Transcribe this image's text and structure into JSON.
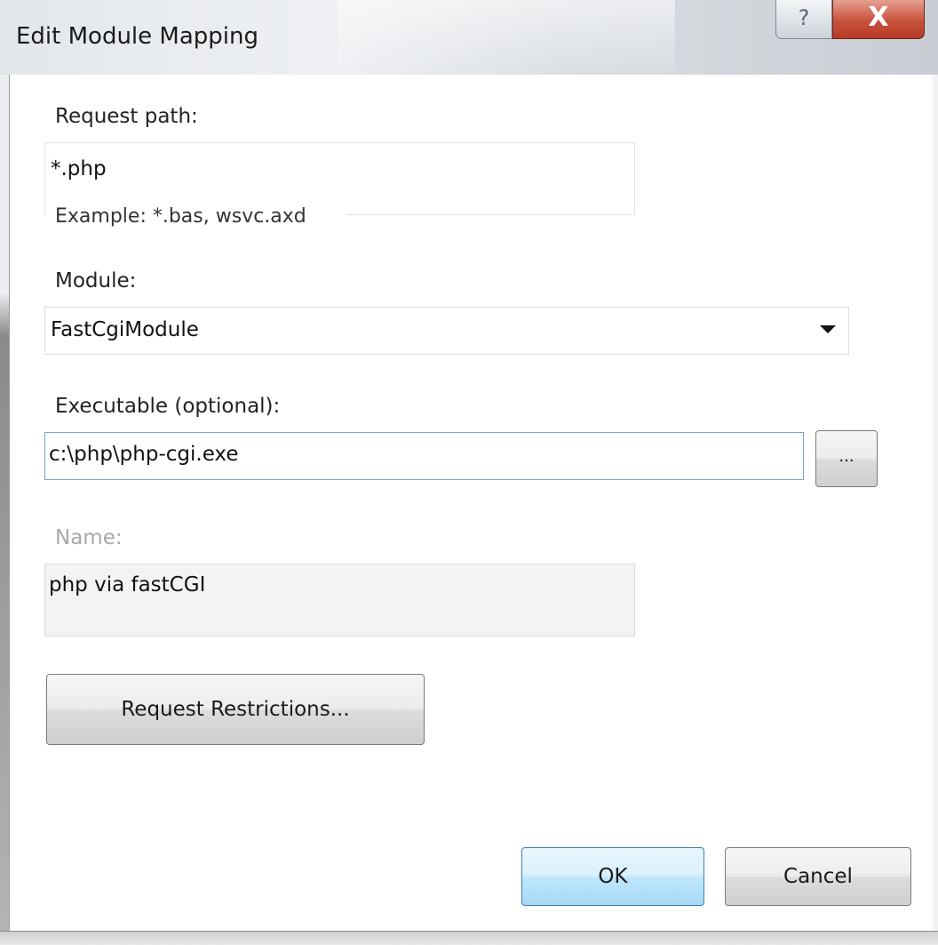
{
  "dialog": {
    "title": "Edit Module Mapping",
    "help_glyph": "?",
    "close_glyph": "X"
  },
  "request_path": {
    "label": "Request path:",
    "value": "*.php",
    "example": "Example: *.bas, wsvc.axd"
  },
  "module": {
    "label": "Module:",
    "selected": "FastCgiModule"
  },
  "executable": {
    "label": "Executable (optional):",
    "value": "c:\\php\\php-cgi.exe",
    "browse_label": "..."
  },
  "name": {
    "label": "Name:",
    "value": "php via fastCGI"
  },
  "buttons": {
    "request_restrictions": "Request Restrictions...",
    "ok": "OK",
    "cancel": "Cancel"
  },
  "colors": {
    "close_button": "#c8523c",
    "ok_button_border": "#3c7fb1",
    "focused_input_border": "#6fa7d6"
  }
}
